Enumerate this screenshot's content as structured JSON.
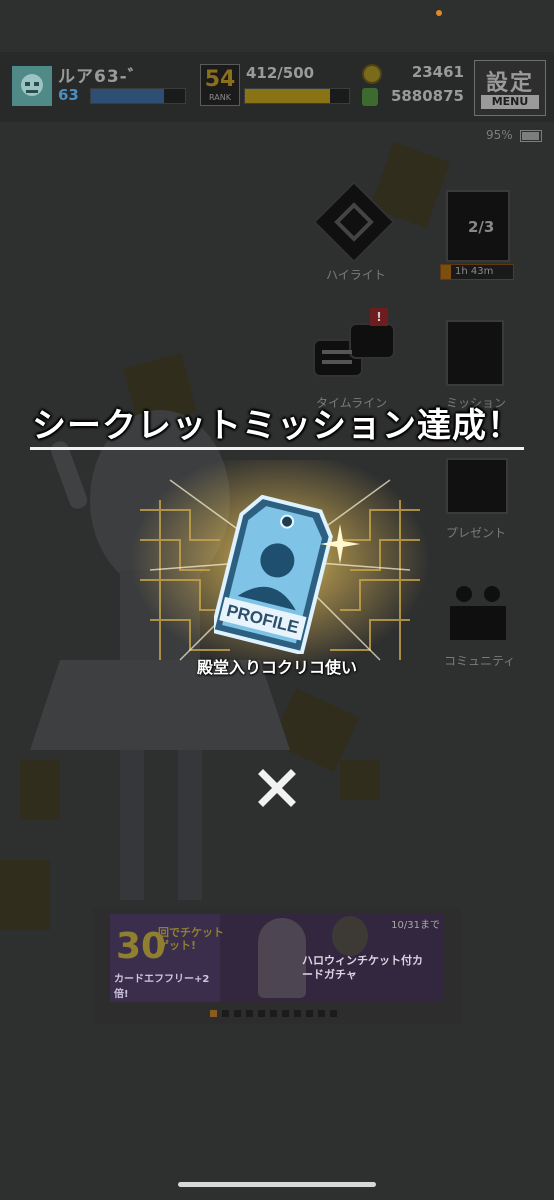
{
  "hud": {
    "player_name": "ルア63-゛",
    "level": "63",
    "exp_fraction": 0.78,
    "rank": "54",
    "rank_label": "RANK",
    "stamina": "412/500",
    "stamina_fraction": 0.82,
    "coins": "23461",
    "money": "5880875",
    "menu_kanji": "設定",
    "menu_label": "MENU",
    "battery": "95%"
  },
  "right_menu": {
    "highlight_label": "ハイライト",
    "timer": "1h 43m",
    "page_badge": "2/3",
    "timeline_label": "タイムライン",
    "mission_label": "ミッション",
    "present_label": "プレゼント",
    "community_label": "コミュニティ",
    "notification_badge": "!"
  },
  "modal": {
    "title": "シークレットミッション達成！",
    "tag_text": "PROFILE",
    "reward_name": "殿堂入りコクリコ使い",
    "close_symbol": "✕"
  },
  "banner": {
    "number": "30",
    "headline": "回でチケットゲット!",
    "subline": "カードエフフリー+2倍!",
    "date": "10/31まで",
    "right_text": "ハロウィンチケット付カードガチャ",
    "dot_count": 11,
    "active_dot": 0
  },
  "colors": {
    "title_text": "#ffffff",
    "glow": "#f3d46b",
    "tag_blue": "#6fb4db"
  }
}
